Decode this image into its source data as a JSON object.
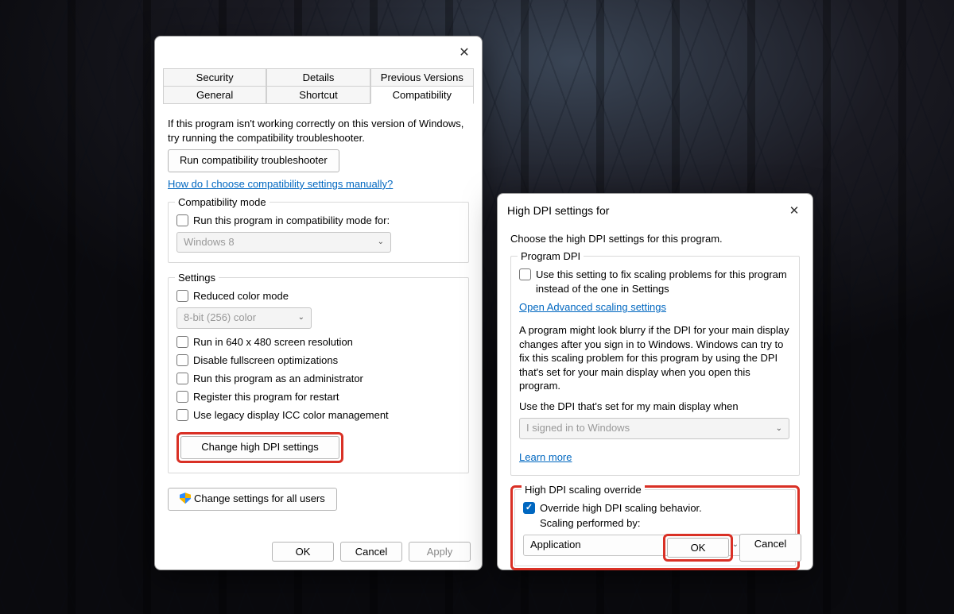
{
  "window1": {
    "tabs_row1": [
      "Security",
      "Details",
      "Previous Versions"
    ],
    "tabs_row2": [
      "General",
      "Shortcut",
      "Compatibility"
    ],
    "intro": "If this program isn't working correctly on this version of Windows, try running the compatibility troubleshooter.",
    "run_troubleshooter": "Run compatibility troubleshooter",
    "manual_link": "How do I choose compatibility settings manually?",
    "compat_mode": {
      "legend": "Compatibility mode",
      "checkbox": "Run this program in compatibility mode for:",
      "select": "Windows 8"
    },
    "settings": {
      "legend": "Settings",
      "reduced_color": "Reduced color mode",
      "color_select": "8-bit (256) color",
      "res": "Run in 640 x 480 screen resolution",
      "disable_full": "Disable fullscreen optimizations",
      "run_admin": "Run this program as an administrator",
      "register_restart": "Register this program for restart",
      "legacy_icc": "Use legacy display ICC color management",
      "change_dpi": "Change high DPI settings"
    },
    "change_all_users": "Change settings for all users",
    "ok": "OK",
    "cancel": "Cancel",
    "apply": "Apply"
  },
  "window2": {
    "title": "High DPI settings for",
    "intro": "Choose the high DPI settings for this program.",
    "program_dpi": {
      "legend": "Program DPI",
      "use_setting": "Use this setting to fix scaling problems for this program instead of the one in Settings",
      "open_adv": "Open Advanced scaling settings",
      "blur_text": "A program might look blurry if the DPI for your main display changes after you sign in to Windows. Windows can try to fix this scaling problem for this program by using the DPI that's set for your main display when you open this program.",
      "use_dpi_when": "Use the DPI that's set for my main display when",
      "when_select": "I signed in to Windows",
      "learn_more": "Learn more"
    },
    "override": {
      "legend": "High DPI scaling override",
      "checkbox": "Override high DPI scaling behavior.",
      "performed_by": "Scaling performed by:",
      "select": "Application"
    },
    "ok": "OK",
    "cancel": "Cancel"
  }
}
